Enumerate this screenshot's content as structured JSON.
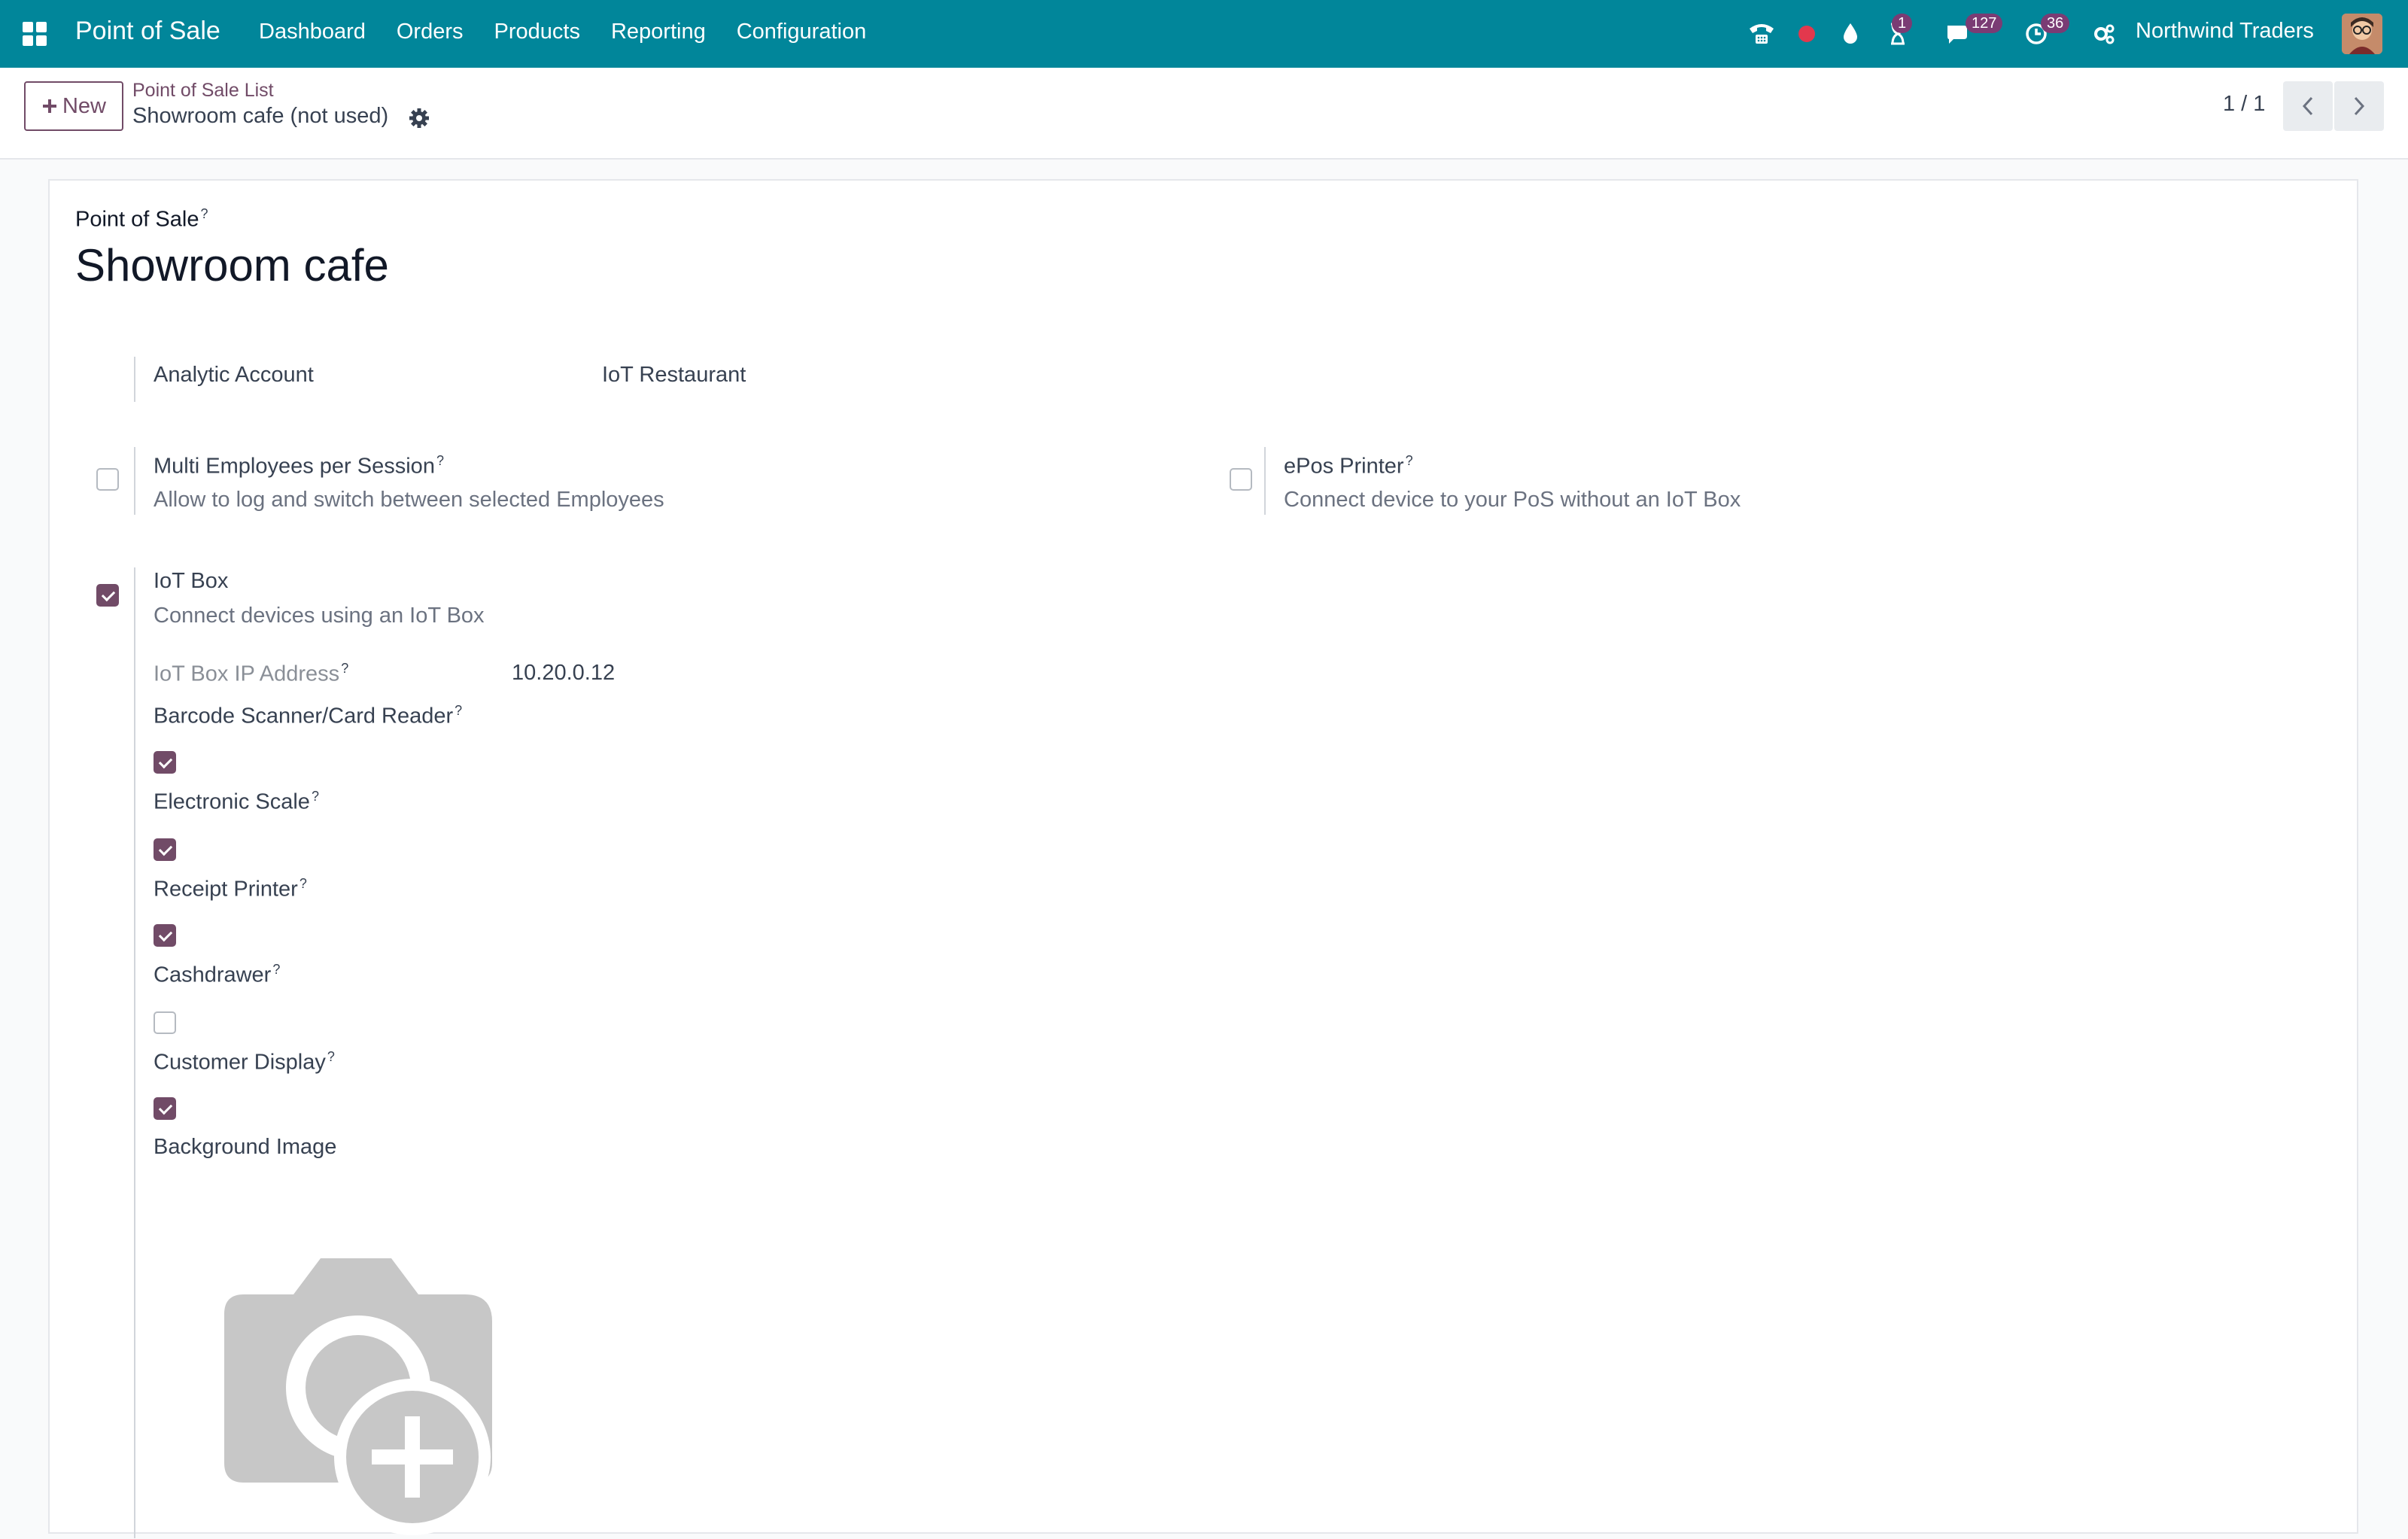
{
  "navbar": {
    "app_title": "Point of Sale",
    "menu": [
      "Dashboard",
      "Orders",
      "Products",
      "Reporting",
      "Configuration"
    ],
    "icons": [
      "apps-grid-icon",
      "phone-icon",
      "record-dot-icon",
      "drop-icon",
      "hourglass-icon",
      "chat-icon",
      "clock-icon",
      "settings-icon"
    ],
    "activity_badge": "1",
    "messages_badge": "127",
    "clock_badge": "36",
    "company": "Northwind Traders"
  },
  "control_panel": {
    "new_label": "New",
    "breadcrumb": "Point of Sale List",
    "record_name": "Showroom cafe (not used)",
    "pager": "1 / 1"
  },
  "form": {
    "pos_label": "Point of Sale",
    "pos_name": "Showroom cafe",
    "analytic_account_label": "Analytic Account",
    "analytic_account_value": "IoT Restaurant",
    "multi_employees": {
      "label": "Multi Employees per Session",
      "desc": "Allow to log and switch between selected Employees",
      "checked": false
    },
    "epos_printer": {
      "label": "ePos Printer",
      "desc": "Connect device to your PoS without an IoT Box",
      "checked": false
    },
    "iot_box": {
      "label": "IoT Box",
      "desc": "Connect devices using an IoT Box",
      "checked": true,
      "ip_label": "IoT Box IP Address",
      "ip_value": "10.20.0.12"
    },
    "devices": [
      {
        "label": "Barcode Scanner/Card Reader",
        "checked": true
      },
      {
        "label": "Electronic Scale",
        "checked": true
      },
      {
        "label": "Receipt Printer",
        "checked": true
      },
      {
        "label": "Cashdrawer",
        "checked": false
      },
      {
        "label": "Customer Display",
        "checked": true
      }
    ],
    "background_image_label": "Background Image"
  },
  "colors": {
    "navbar": "#01869a",
    "primary": "#714b67",
    "badge": "#7a3c74"
  }
}
